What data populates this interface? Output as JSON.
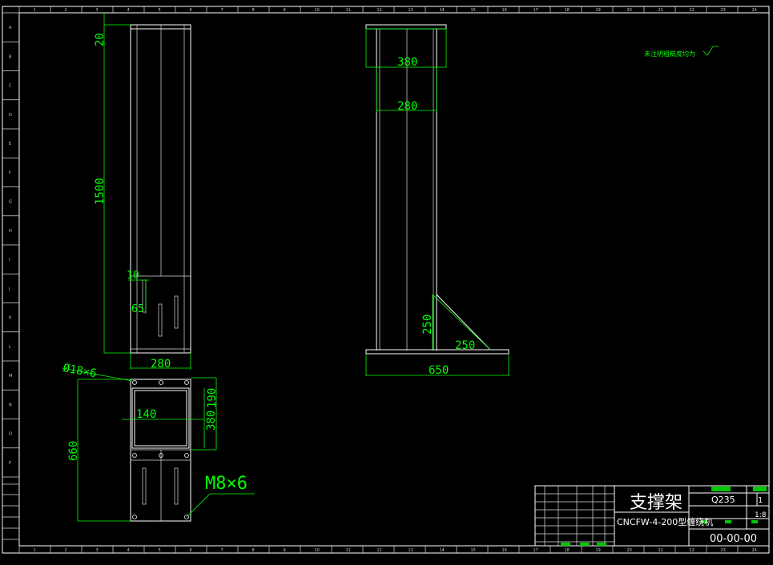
{
  "drawing": {
    "border": {
      "top_zones": [
        "1",
        "2",
        "3",
        "4",
        "5",
        "6",
        "7",
        "8",
        "9",
        "10",
        "11",
        "12",
        "13",
        "14",
        "15",
        "16",
        "17",
        "18",
        "19",
        "20",
        "21",
        "22",
        "23",
        "24"
      ],
      "left_zones": [
        "A",
        "B",
        "C",
        "D",
        "E",
        "F",
        "G",
        "H",
        "I",
        "J",
        "K",
        "L",
        "M",
        "N",
        "O",
        "P"
      ]
    },
    "front_view": {
      "dim_top": "20",
      "dim_height": "1500",
      "dim_slot_width": "10",
      "dim_slot_height": "65",
      "dim_width": "280"
    },
    "side_view": {
      "dim_top_outer": "380",
      "dim_top_inner": "280",
      "dim_gusset_height": "250",
      "dim_gusset_width": "250",
      "dim_base": "650"
    },
    "top_view": {
      "hole_note": "Ø18×6",
      "dim_inner": "140",
      "dim_190": "190",
      "dim_380": "380",
      "dim_660": "660",
      "thread_note": "M8×6"
    },
    "roughness_note": "未注明粗糙度均为",
    "title_block": {
      "part_name": "支撑架",
      "assembly": "CNCFW-4-200型缠绕机",
      "material": "Q235",
      "quantity": "1",
      "scale": "1:8",
      "drawing_no": "00-00-00"
    }
  },
  "colors": {
    "background": "#000000",
    "outline": "#ffffff",
    "dimension": "#00ff00",
    "green_cell": "#00c800"
  }
}
